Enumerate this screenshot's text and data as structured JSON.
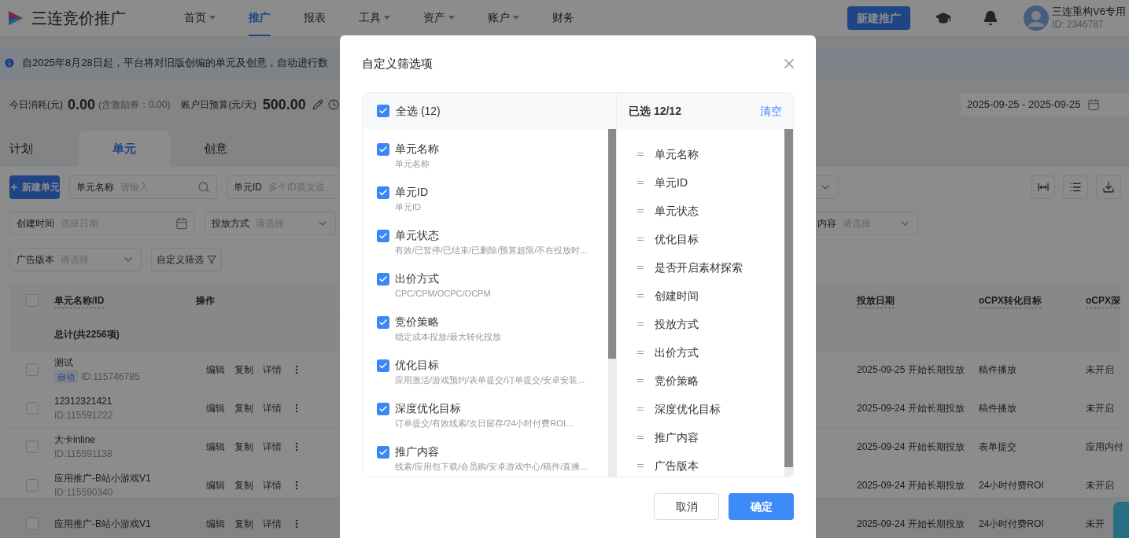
{
  "nav": {
    "logo_text": "三连竞价推广",
    "menu": [
      {
        "label": "首页",
        "dropdown": true,
        "selected": false
      },
      {
        "label": "推广",
        "dropdown": false,
        "selected": true
      },
      {
        "label": "报表",
        "dropdown": false,
        "selected": false
      },
      {
        "label": "工具",
        "dropdown": true,
        "selected": false
      },
      {
        "label": "资产",
        "dropdown": true,
        "selected": false
      },
      {
        "label": "账户",
        "dropdown": true,
        "selected": false
      },
      {
        "label": "财务",
        "dropdown": false,
        "selected": false
      }
    ],
    "new_button": "新建推广",
    "account": {
      "name": "三连重构V6专用",
      "id": "ID: 2346787"
    }
  },
  "notice": "自2025年8月28日起，平台将对旧版创编的单元及创意，自动进行数",
  "stats": {
    "today_label": "今日消耗(元)",
    "today_value": "0.00",
    "today_note": "(含激励券：0.00)",
    "budget_label": "账户日预算(元/天)",
    "budget_value": "500.00",
    "date_range": "2025-09-25 - 2025-09-25"
  },
  "tabs": [
    {
      "label": "计划",
      "selected": false
    },
    {
      "label": "单元",
      "selected": true
    },
    {
      "label": "创意",
      "selected": false
    }
  ],
  "toolbar": {
    "new_button": "新建单元",
    "row_1": [
      {
        "kind": "search",
        "label": "单元名称",
        "placeholder": "请输入"
      },
      {
        "kind": "text",
        "label": "单元ID",
        "placeholder": "多个ID英文逗"
      }
    ],
    "row_2": [
      {
        "kind": "date",
        "label": "创建时间",
        "placeholder": "选择日期"
      },
      {
        "kind": "select",
        "label": "投放方式",
        "placeholder": "请选择"
      },
      {
        "kind": "select",
        "label": "内容",
        "placeholder": "请选择"
      }
    ],
    "row_3": [
      {
        "kind": "select",
        "label": "广告版本",
        "placeholder": "请选择"
      }
    ],
    "custom_filter": "自定义筛选"
  },
  "table": {
    "all_checked": false,
    "columns": [
      "单元名称/ID",
      "操作",
      "投放日期",
      "oCPX转化目标",
      "oCPX深"
    ],
    "total": "总计(共2256项)",
    "rows": [
      {
        "checked": false,
        "name": "测试",
        "tag": "自动",
        "id": "ID:115746785",
        "actions": [
          "编辑",
          "复制",
          "详情"
        ],
        "date": "2025-09-25 开始长期投放",
        "ocpx": "稿件播放",
        "deep": "未开启"
      },
      {
        "checked": false,
        "name": "12312321421",
        "id": "ID:115591222",
        "actions": [
          "编辑",
          "复制",
          "详情"
        ],
        "date": "2025-09-24 开始长期投放",
        "ocpx": "稿件播放",
        "deep": "未开启"
      },
      {
        "checked": false,
        "name": "大卡inline",
        "id": "ID:115591138",
        "actions": [
          "编辑",
          "复制",
          "详情"
        ],
        "date": "2025-09-24 开始长期投放",
        "ocpx": "表单提交",
        "deep": "应用内付"
      },
      {
        "checked": false,
        "name": "应用推广-B站小游戏V1",
        "id": "ID:115590340",
        "actions": [
          "编辑",
          "复制",
          "详情"
        ],
        "date": "2025-09-24 开始长期投放",
        "ocpx": "24小时付费ROI",
        "deep": "未开启"
      },
      {
        "checked": false,
        "name": "应用推广-B站小游戏V1",
        "actions": [
          "编辑",
          "复制",
          "详情"
        ],
        "date": "2025-09-24 开始长期投放",
        "ocpx": "24小时付费ROI",
        "deep": "未开"
      }
    ]
  },
  "modal": {
    "title": "自定义筛选项",
    "select_all": {
      "label": "全选 (12)",
      "checked": true
    },
    "selected_count": "已选 12/12",
    "clear": "清空",
    "options": [
      {
        "label": "单元名称",
        "description": "单元名称",
        "checked": true
      },
      {
        "label": "单元ID",
        "description": "单元ID",
        "checked": true
      },
      {
        "label": "单元状态",
        "description": "有效/已暂停/已结束/已删除/预算超限/不在投放时...",
        "checked": true
      },
      {
        "label": "出价方式",
        "description": "CPC/CPM/OCPC/OCPM",
        "checked": true
      },
      {
        "label": "竞价策略",
        "description": "稳定成本投放/最大转化投放",
        "checked": true
      },
      {
        "label": "优化目标",
        "description": "应用激活/游戏预约/表单提交/订单提交/安卓安装...",
        "checked": true
      },
      {
        "label": "深度优化目标",
        "description": "订单提交/有效线索/次日留存/24小时付费ROI...",
        "checked": true
      },
      {
        "label": "推广内容",
        "description": "线索/应用包下载/会员购/安卓游戏中心/稿件/直播...",
        "checked": true
      }
    ],
    "selected_items": [
      "单元名称",
      "单元ID",
      "单元状态",
      "优化目标",
      "是否开启素材探索",
      "创建时间",
      "投放方式",
      "出价方式",
      "竞价策略",
      "深度优化目标",
      "推广内容",
      "广告版本"
    ],
    "cancel": "取消",
    "confirm": "确定"
  }
}
